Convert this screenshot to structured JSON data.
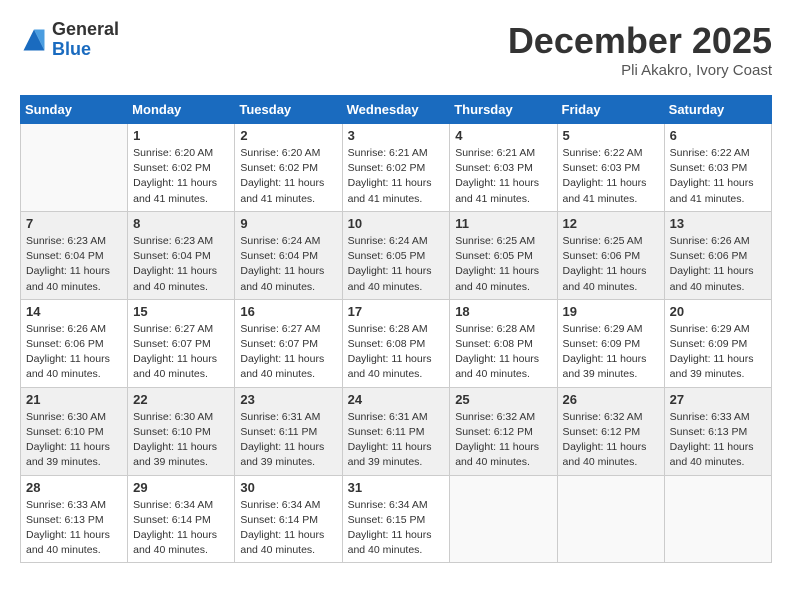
{
  "header": {
    "logo_line1": "General",
    "logo_line2": "Blue",
    "month": "December 2025",
    "location": "Pli Akakro, Ivory Coast"
  },
  "days_of_week": [
    "Sunday",
    "Monday",
    "Tuesday",
    "Wednesday",
    "Thursday",
    "Friday",
    "Saturday"
  ],
  "weeks": [
    [
      {
        "day": "",
        "info": ""
      },
      {
        "day": "1",
        "info": "Sunrise: 6:20 AM\nSunset: 6:02 PM\nDaylight: 11 hours and 41 minutes."
      },
      {
        "day": "2",
        "info": "Sunrise: 6:20 AM\nSunset: 6:02 PM\nDaylight: 11 hours and 41 minutes."
      },
      {
        "day": "3",
        "info": "Sunrise: 6:21 AM\nSunset: 6:02 PM\nDaylight: 11 hours and 41 minutes."
      },
      {
        "day": "4",
        "info": "Sunrise: 6:21 AM\nSunset: 6:03 PM\nDaylight: 11 hours and 41 minutes."
      },
      {
        "day": "5",
        "info": "Sunrise: 6:22 AM\nSunset: 6:03 PM\nDaylight: 11 hours and 41 minutes."
      },
      {
        "day": "6",
        "info": "Sunrise: 6:22 AM\nSunset: 6:03 PM\nDaylight: 11 hours and 41 minutes."
      }
    ],
    [
      {
        "day": "7",
        "info": "Sunrise: 6:23 AM\nSunset: 6:04 PM\nDaylight: 11 hours and 40 minutes."
      },
      {
        "day": "8",
        "info": "Sunrise: 6:23 AM\nSunset: 6:04 PM\nDaylight: 11 hours and 40 minutes."
      },
      {
        "day": "9",
        "info": "Sunrise: 6:24 AM\nSunset: 6:04 PM\nDaylight: 11 hours and 40 minutes."
      },
      {
        "day": "10",
        "info": "Sunrise: 6:24 AM\nSunset: 6:05 PM\nDaylight: 11 hours and 40 minutes."
      },
      {
        "day": "11",
        "info": "Sunrise: 6:25 AM\nSunset: 6:05 PM\nDaylight: 11 hours and 40 minutes."
      },
      {
        "day": "12",
        "info": "Sunrise: 6:25 AM\nSunset: 6:06 PM\nDaylight: 11 hours and 40 minutes."
      },
      {
        "day": "13",
        "info": "Sunrise: 6:26 AM\nSunset: 6:06 PM\nDaylight: 11 hours and 40 minutes."
      }
    ],
    [
      {
        "day": "14",
        "info": "Sunrise: 6:26 AM\nSunset: 6:06 PM\nDaylight: 11 hours and 40 minutes."
      },
      {
        "day": "15",
        "info": "Sunrise: 6:27 AM\nSunset: 6:07 PM\nDaylight: 11 hours and 40 minutes."
      },
      {
        "day": "16",
        "info": "Sunrise: 6:27 AM\nSunset: 6:07 PM\nDaylight: 11 hours and 40 minutes."
      },
      {
        "day": "17",
        "info": "Sunrise: 6:28 AM\nSunset: 6:08 PM\nDaylight: 11 hours and 40 minutes."
      },
      {
        "day": "18",
        "info": "Sunrise: 6:28 AM\nSunset: 6:08 PM\nDaylight: 11 hours and 40 minutes."
      },
      {
        "day": "19",
        "info": "Sunrise: 6:29 AM\nSunset: 6:09 PM\nDaylight: 11 hours and 39 minutes."
      },
      {
        "day": "20",
        "info": "Sunrise: 6:29 AM\nSunset: 6:09 PM\nDaylight: 11 hours and 39 minutes."
      }
    ],
    [
      {
        "day": "21",
        "info": "Sunrise: 6:30 AM\nSunset: 6:10 PM\nDaylight: 11 hours and 39 minutes."
      },
      {
        "day": "22",
        "info": "Sunrise: 6:30 AM\nSunset: 6:10 PM\nDaylight: 11 hours and 39 minutes."
      },
      {
        "day": "23",
        "info": "Sunrise: 6:31 AM\nSunset: 6:11 PM\nDaylight: 11 hours and 39 minutes."
      },
      {
        "day": "24",
        "info": "Sunrise: 6:31 AM\nSunset: 6:11 PM\nDaylight: 11 hours and 39 minutes."
      },
      {
        "day": "25",
        "info": "Sunrise: 6:32 AM\nSunset: 6:12 PM\nDaylight: 11 hours and 40 minutes."
      },
      {
        "day": "26",
        "info": "Sunrise: 6:32 AM\nSunset: 6:12 PM\nDaylight: 11 hours and 40 minutes."
      },
      {
        "day": "27",
        "info": "Sunrise: 6:33 AM\nSunset: 6:13 PM\nDaylight: 11 hours and 40 minutes."
      }
    ],
    [
      {
        "day": "28",
        "info": "Sunrise: 6:33 AM\nSunset: 6:13 PM\nDaylight: 11 hours and 40 minutes."
      },
      {
        "day": "29",
        "info": "Sunrise: 6:34 AM\nSunset: 6:14 PM\nDaylight: 11 hours and 40 minutes."
      },
      {
        "day": "30",
        "info": "Sunrise: 6:34 AM\nSunset: 6:14 PM\nDaylight: 11 hours and 40 minutes."
      },
      {
        "day": "31",
        "info": "Sunrise: 6:34 AM\nSunset: 6:15 PM\nDaylight: 11 hours and 40 minutes."
      },
      {
        "day": "",
        "info": ""
      },
      {
        "day": "",
        "info": ""
      },
      {
        "day": "",
        "info": ""
      }
    ]
  ]
}
